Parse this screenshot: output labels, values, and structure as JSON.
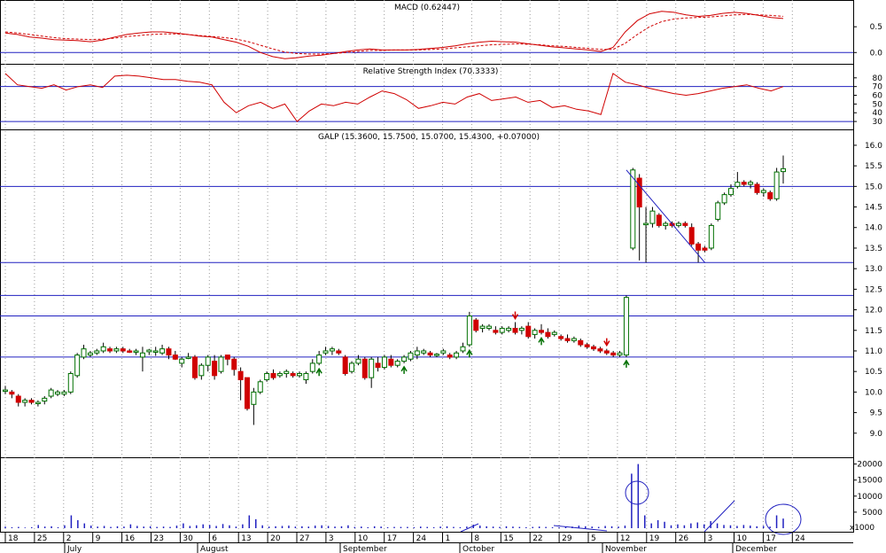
{
  "chart_data": [
    {
      "type": "line",
      "title": "MACD (0.62447)",
      "ylim": [
        -0.15,
        0.95
      ],
      "yticks": [
        "0.5",
        "0.0"
      ],
      "ytick_values": [
        0.5,
        0.0
      ],
      "colors": {
        "macd": "#d00000",
        "signal": "#d00000",
        "zero": "#2020c0"
      },
      "series": [
        {
          "key": "macd",
          "values": [
            0.38,
            0.35,
            0.3,
            0.28,
            0.25,
            0.24,
            0.23,
            0.21,
            0.24,
            0.3,
            0.35,
            0.38,
            0.4,
            0.4,
            0.38,
            0.35,
            0.32,
            0.3,
            0.25,
            0.2,
            0.12,
            0.0,
            -0.08,
            -0.12,
            -0.1,
            -0.07,
            -0.05,
            -0.02,
            0.02,
            0.05,
            0.07,
            0.05,
            0.05,
            0.05,
            0.06,
            0.08,
            0.1,
            0.13,
            0.17,
            0.2,
            0.22,
            0.21,
            0.2,
            0.17,
            0.14,
            0.11,
            0.09,
            0.07,
            0.05,
            0.02,
            0.1,
            0.4,
            0.62,
            0.75,
            0.8,
            0.78,
            0.73,
            0.7,
            0.72,
            0.76,
            0.78,
            0.76,
            0.72,
            0.68,
            0.66
          ]
        },
        {
          "key": "signal",
          "values": [
            0.4,
            0.38,
            0.35,
            0.32,
            0.29,
            0.27,
            0.26,
            0.25,
            0.26,
            0.28,
            0.31,
            0.33,
            0.35,
            0.36,
            0.36,
            0.35,
            0.33,
            0.31,
            0.29,
            0.26,
            0.21,
            0.14,
            0.07,
            0.01,
            -0.02,
            -0.03,
            -0.03,
            -0.02,
            0.0,
            0.02,
            0.04,
            0.04,
            0.05,
            0.05,
            0.05,
            0.06,
            0.07,
            0.09,
            0.11,
            0.13,
            0.15,
            0.16,
            0.17,
            0.16,
            0.15,
            0.13,
            0.12,
            0.1,
            0.08,
            0.06,
            0.06,
            0.18,
            0.35,
            0.5,
            0.6,
            0.65,
            0.67,
            0.68,
            0.69,
            0.71,
            0.73,
            0.74,
            0.73,
            0.72,
            0.7
          ]
        }
      ]
    },
    {
      "type": "line",
      "title": "Relative Strength Index (70.3333)",
      "ylim": [
        25,
        92
      ],
      "yticks": [
        "80",
        "70",
        "60",
        "50",
        "40",
        "30"
      ],
      "ytick_values": [
        80,
        70,
        60,
        50,
        40,
        30
      ],
      "reference_lines": [
        70,
        30
      ],
      "colors": {
        "rsi": "#d00000",
        "ref": "#2020c0"
      },
      "series": [
        {
          "key": "rsi",
          "values": [
            85,
            72,
            70,
            68,
            72,
            66,
            70,
            72,
            69,
            82,
            83,
            82,
            80,
            78,
            78,
            76,
            75,
            72,
            52,
            40,
            48,
            52,
            45,
            50,
            30,
            42,
            50,
            48,
            52,
            50,
            58,
            65,
            62,
            55,
            45,
            48,
            52,
            50,
            58,
            62,
            54,
            56,
            58,
            52,
            54,
            46,
            48,
            44,
            42,
            38,
            85,
            75,
            72,
            68,
            65,
            62,
            60,
            62,
            65,
            68,
            70,
            72,
            68,
            65,
            70
          ]
        }
      ]
    },
    {
      "type": "candlestick",
      "title": "GALP (15.3600, 15.7500, 15.0700, 15.4300, +0.07000)",
      "ylim": [
        8.5,
        16.3
      ],
      "yticks": [
        "16.0",
        "15.5",
        "15.0",
        "14.5",
        "14.0",
        "13.5",
        "13.0",
        "12.5",
        "12.0",
        "11.5",
        "11.0",
        "10.5",
        "10.0",
        "9.5",
        "9.0"
      ],
      "ytick_values": [
        16.0,
        15.5,
        15.0,
        14.5,
        14.0,
        13.5,
        13.0,
        12.5,
        12.0,
        11.5,
        11.0,
        10.5,
        10.0,
        9.5,
        9.0
      ],
      "horizontal_lines": [
        15.0,
        13.15,
        12.35,
        11.85,
        10.85
      ],
      "trend_line": {
        "from": {
          "date": "November 9",
          "price": 15.4
        },
        "to": {
          "date": "November 26",
          "price": 13.15
        }
      },
      "colors": {
        "up": "#007000",
        "down": "#d00000",
        "wick": "#000000",
        "lines": "#2020c0",
        "arrow_up": "#007000",
        "arrow_down": "#d00000"
      },
      "up_arrows": [
        17,
        30,
        40,
        51,
        64
      ],
      "down_arrows": [
        47,
        61
      ],
      "candles": [
        [
          10.05,
          10.15,
          9.95,
          10.05
        ],
        [
          10.0,
          10.05,
          9.85,
          9.95
        ],
        [
          9.9,
          9.95,
          9.65,
          9.75
        ],
        [
          9.75,
          9.85,
          9.65,
          9.8
        ],
        [
          9.8,
          9.85,
          9.7,
          9.75
        ],
        [
          9.72,
          9.8,
          9.65,
          9.75
        ],
        [
          9.78,
          9.9,
          9.7,
          9.85
        ],
        [
          9.9,
          10.1,
          9.85,
          10.05
        ],
        [
          9.95,
          10.05,
          9.9,
          10.0
        ],
        [
          9.95,
          10.05,
          9.9,
          10.0
        ],
        [
          10.0,
          10.5,
          9.95,
          10.45
        ],
        [
          10.4,
          10.95,
          10.35,
          10.9
        ],
        [
          10.85,
          11.15,
          10.8,
          11.05
        ],
        [
          10.9,
          11.0,
          10.85,
          10.95
        ],
        [
          10.95,
          11.05,
          10.9,
          11.0
        ],
        [
          11.0,
          11.2,
          10.95,
          11.1
        ],
        [
          11.05,
          11.1,
          10.95,
          11.0
        ],
        [
          11.0,
          11.1,
          10.95,
          11.05
        ],
        [
          11.05,
          11.1,
          10.95,
          11.0
        ],
        [
          11.0,
          11.05,
          10.95,
          10.97
        ],
        [
          10.97,
          11.05,
          10.9,
          11.0
        ],
        [
          10.85,
          11.1,
          10.5,
          10.95
        ],
        [
          10.98,
          11.05,
          10.9,
          11.02
        ],
        [
          10.99,
          11.1,
          10.88,
          11.0
        ],
        [
          10.95,
          11.15,
          10.9,
          11.05
        ],
        [
          11.05,
          11.1,
          10.8,
          10.9
        ],
        [
          10.9,
          11.0,
          10.78,
          10.8
        ],
        [
          10.7,
          10.85,
          10.6,
          10.8
        ],
        [
          10.85,
          10.95,
          10.8,
          10.85
        ],
        [
          10.85,
          10.9,
          10.3,
          10.35
        ],
        [
          10.4,
          10.7,
          10.3,
          10.65
        ],
        [
          10.65,
          10.9,
          10.5,
          10.85
        ],
        [
          10.75,
          10.9,
          10.3,
          10.4
        ],
        [
          10.5,
          10.9,
          10.45,
          10.85
        ],
        [
          10.9,
          10.9,
          10.65,
          10.8
        ],
        [
          10.8,
          10.85,
          10.4,
          10.55
        ],
        [
          10.5,
          10.6,
          9.8,
          10.3
        ],
        [
          10.35,
          10.35,
          9.55,
          9.6
        ],
        [
          9.7,
          10.1,
          9.2,
          10.0
        ],
        [
          10.0,
          10.3,
          9.95,
          10.25
        ],
        [
          10.3,
          10.5,
          10.25,
          10.45
        ],
        [
          10.45,
          10.55,
          10.3,
          10.35
        ],
        [
          10.4,
          10.5,
          10.35,
          10.45
        ],
        [
          10.45,
          10.55,
          10.35,
          10.5
        ],
        [
          10.45,
          10.5,
          10.35,
          10.4
        ],
        [
          10.4,
          10.5,
          10.35,
          10.45
        ],
        [
          10.3,
          10.5,
          10.2,
          10.45
        ],
        [
          10.5,
          10.8,
          10.45,
          10.7
        ],
        [
          10.7,
          11.0,
          10.65,
          10.9
        ],
        [
          10.95,
          11.1,
          10.9,
          11.0
        ],
        [
          11.0,
          11.1,
          10.9,
          11.05
        ],
        [
          11.0,
          11.05,
          10.9,
          10.95
        ],
        [
          10.85,
          10.9,
          10.4,
          10.45
        ],
        [
          10.5,
          10.75,
          10.45,
          10.7
        ],
        [
          10.7,
          10.9,
          10.65,
          10.8
        ],
        [
          10.8,
          10.85,
          10.3,
          10.35
        ],
        [
          10.35,
          10.85,
          10.1,
          10.8
        ],
        [
          10.7,
          10.85,
          10.5,
          10.6
        ],
        [
          10.6,
          10.9,
          10.55,
          10.85
        ],
        [
          10.8,
          10.9,
          10.6,
          10.65
        ],
        [
          10.65,
          10.8,
          10.6,
          10.75
        ],
        [
          10.75,
          10.9,
          10.7,
          10.85
        ],
        [
          10.8,
          11.0,
          10.75,
          10.95
        ],
        [
          10.9,
          11.1,
          10.8,
          11.0
        ],
        [
          10.95,
          11.05,
          10.9,
          11.0
        ],
        [
          10.95,
          11.0,
          10.85,
          10.9
        ],
        [
          10.9,
          10.95,
          10.85,
          10.92
        ],
        [
          10.95,
          11.05,
          10.9,
          11.0
        ],
        [
          10.9,
          10.95,
          10.8,
          10.85
        ],
        [
          10.85,
          11.0,
          10.8,
          10.95
        ],
        [
          11.0,
          11.2,
          10.95,
          11.1
        ],
        [
          11.15,
          11.95,
          11.1,
          11.85
        ],
        [
          11.75,
          11.8,
          11.45,
          11.5
        ],
        [
          11.55,
          11.65,
          11.45,
          11.6
        ],
        [
          11.55,
          11.65,
          11.5,
          11.6
        ],
        [
          11.5,
          11.6,
          11.4,
          11.45
        ],
        [
          11.45,
          11.6,
          11.4,
          11.55
        ],
        [
          11.5,
          11.6,
          11.45,
          11.55
        ],
        [
          11.55,
          11.7,
          11.4,
          11.45
        ],
        [
          11.5,
          11.6,
          11.4,
          11.55
        ],
        [
          11.6,
          11.7,
          11.3,
          11.35
        ],
        [
          11.4,
          11.55,
          11.3,
          11.5
        ],
        [
          11.5,
          11.65,
          11.4,
          11.45
        ],
        [
          11.45,
          11.55,
          11.3,
          11.35
        ],
        [
          11.4,
          11.5,
          11.35,
          11.45
        ],
        [
          11.35,
          11.4,
          11.25,
          11.3
        ],
        [
          11.3,
          11.4,
          11.2,
          11.25
        ],
        [
          11.25,
          11.35,
          11.2,
          11.3
        ],
        [
          11.25,
          11.3,
          11.1,
          11.15
        ],
        [
          11.15,
          11.2,
          11.05,
          11.1
        ],
        [
          11.1,
          11.15,
          11.0,
          11.05
        ],
        [
          11.05,
          11.1,
          10.95,
          11.0
        ],
        [
          11.0,
          11.05,
          10.9,
          10.95
        ],
        [
          10.95,
          11.0,
          10.85,
          10.9
        ],
        [
          10.9,
          11.0,
          10.85,
          10.95
        ],
        [
          10.9,
          12.35,
          10.85,
          12.3
        ],
        [
          13.5,
          15.45,
          13.45,
          15.4
        ],
        [
          15.2,
          15.3,
          13.2,
          14.5
        ],
        [
          14.1,
          14.5,
          13.15,
          14.1
        ],
        [
          14.1,
          14.5,
          14.0,
          14.4
        ],
        [
          14.3,
          14.35,
          14.0,
          14.05
        ],
        [
          14.05,
          14.15,
          13.95,
          14.1
        ],
        [
          14.1,
          14.15,
          14.0,
          14.05
        ],
        [
          14.05,
          14.15,
          14.0,
          14.1
        ],
        [
          14.1,
          14.15,
          14.0,
          14.05
        ],
        [
          14.0,
          14.1,
          13.55,
          13.6
        ],
        [
          13.6,
          13.65,
          13.15,
          13.45
        ],
        [
          13.5,
          13.55,
          13.4,
          13.45
        ],
        [
          13.5,
          14.1,
          13.45,
          14.05
        ],
        [
          14.2,
          14.65,
          14.15,
          14.6
        ],
        [
          14.6,
          14.85,
          14.55,
          14.8
        ],
        [
          14.8,
          15.05,
          14.75,
          14.95
        ],
        [
          15.0,
          15.35,
          14.95,
          15.1
        ],
        [
          15.1,
          15.15,
          15.0,
          15.05
        ],
        [
          15.05,
          15.15,
          14.95,
          15.1
        ],
        [
          15.05,
          15.1,
          14.8,
          14.85
        ],
        [
          14.85,
          14.95,
          14.75,
          14.9
        ],
        [
          14.85,
          14.9,
          14.65,
          14.7
        ],
        [
          14.7,
          15.45,
          14.65,
          15.35
        ],
        [
          15.36,
          15.75,
          15.07,
          15.43
        ]
      ]
    },
    {
      "type": "bar",
      "title": "",
      "ylabel": "x1000",
      "ylim": [
        0,
        21000
      ],
      "yticks": [
        "20000",
        "15000",
        "10000",
        "5000"
      ],
      "ytick_values": [
        20000,
        15000,
        10000,
        5000
      ],
      "colors": {
        "bar": "#2020c0",
        "highlight": "#2020c0"
      },
      "values": [
        500,
        300,
        400,
        200,
        300,
        1000,
        500,
        600,
        300,
        900,
        4000,
        2500,
        1500,
        800,
        500,
        700,
        400,
        600,
        500,
        1200,
        700,
        500,
        600,
        400,
        500,
        400,
        800,
        1500,
        700,
        900,
        1200,
        1000,
        700,
        1300,
        900,
        500,
        1200,
        4000,
        2800,
        900,
        500,
        600,
        700,
        800,
        500,
        600,
        500,
        800,
        900,
        700,
        500,
        600,
        900,
        400,
        500,
        300,
        600,
        500,
        300,
        400,
        400,
        400,
        300,
        500,
        400,
        300,
        500,
        600,
        400,
        300,
        500,
        1100,
        800,
        600,
        500,
        400,
        600,
        500,
        400,
        300,
        400,
        500,
        400,
        300,
        300,
        400,
        500,
        800,
        600,
        500,
        400,
        700,
        600,
        500,
        800,
        17000,
        20000,
        4000,
        1500,
        2500,
        2000,
        900,
        1200,
        900,
        1500,
        1800,
        1200,
        2200,
        1500,
        1000,
        900,
        700,
        1000,
        800,
        600,
        700,
        500,
        4000,
        3000
      ],
      "highlighted_circles": [
        "November 9",
        "December 13"
      ],
      "annotation_lines": [
        {
          "from": {
            "date": "October 1",
            "value": 0
          },
          "to": {
            "date": "October 4",
            "value": 2500
          }
        },
        {
          "from": {
            "date": "October 29",
            "value": 1500
          },
          "to": {
            "date": "November 8",
            "value": 300
          }
        },
        {
          "from": {
            "date": "November 26",
            "value": 0
          },
          "to": {
            "date": "December 3",
            "value": 10000
          }
        }
      ]
    }
  ],
  "x_axis": {
    "day_labels": [
      "18",
      "25",
      "2",
      "9",
      "16",
      "23",
      "30",
      "6",
      "13",
      "20",
      "27",
      "3",
      "10",
      "17",
      "24",
      "1",
      "8",
      "15",
      "22",
      "29",
      "5",
      "12",
      "19",
      "26",
      "3",
      "10",
      "17",
      "24"
    ],
    "months": [
      "July",
      "August",
      "September",
      "October",
      "November",
      "December"
    ]
  }
}
